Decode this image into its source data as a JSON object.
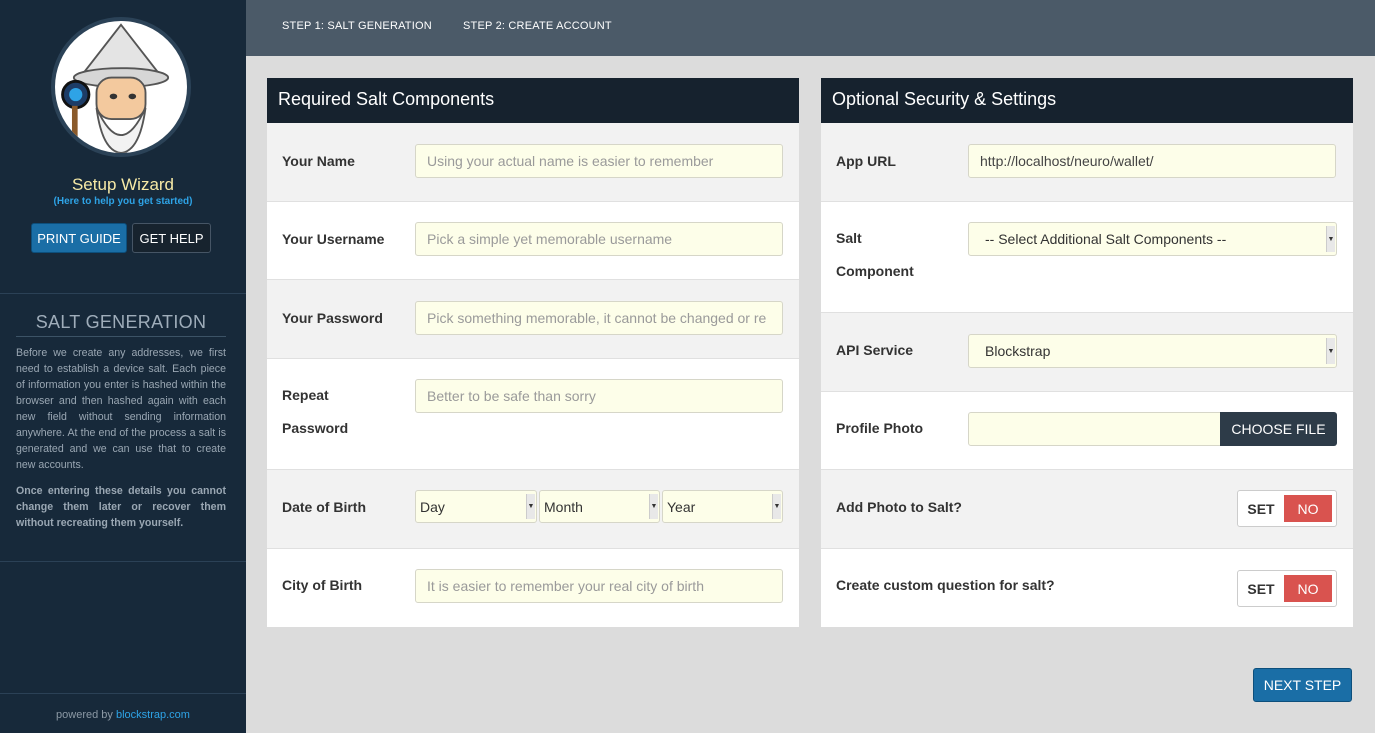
{
  "sidebar": {
    "title": "Setup Wizard",
    "subtitle": "(Here to help you get started)",
    "print_guide": "PRINT GUIDE",
    "get_help": "GET HELP",
    "section_title": "SALT GENERATION",
    "description": "Before we create any addresses, we first need to establish a device salt. Each piece of information you enter is hashed within the browser and then hashed again with each new field without sending information anywhere. At the end of the process a salt is generated and we can use that to create new accounts.",
    "warning": "Once entering these details you cannot change them later or recover them without recreating them yourself.",
    "powered_prefix": "powered by",
    "powered_link": "blockstrap.com"
  },
  "nav": {
    "step1": "STEP 1: SALT GENERATION",
    "step2": "STEP 2: CREATE ACCOUNT"
  },
  "required": {
    "title": "Required Salt Components",
    "name_label": "Your Name",
    "name_placeholder": "Using your actual name is easier to remember",
    "username_label": "Your Username",
    "username_placeholder": "Pick a simple yet memorable username",
    "password_label": "Your Password",
    "password_placeholder": "Pick something memorable, it cannot be changed or re",
    "repeat_label_1": "Repeat",
    "repeat_label_2": "Password",
    "repeat_placeholder": "Better to be safe than sorry",
    "dob_label": "Date of Birth",
    "dob_day": "Day",
    "dob_month": "Month",
    "dob_year": "Year",
    "city_label": "City of Birth",
    "city_placeholder": "It is easier to remember your real city of birth"
  },
  "optional": {
    "title": "Optional Security & Settings",
    "app_url_label": "App URL",
    "app_url_value": "http://localhost/neuro/wallet/",
    "salt_label_1": "Salt",
    "salt_label_2": "Component",
    "salt_select": "-- Select Additional Salt Components --",
    "api_label": "API Service",
    "api_value": "Blockstrap",
    "photo_label": "Profile Photo",
    "choose_file": "CHOOSE FILE",
    "add_photo_label": "Add Photo to Salt?",
    "custom_question_label": "Create custom question for salt?",
    "toggle_set": "SET",
    "toggle_no": "NO"
  },
  "next_step": "NEXT STEP",
  "colors": {
    "sidebar_bg": "#17293a",
    "panel_head": "#16222e",
    "accent_blue": "#1a6ea6",
    "toggle_red": "#d9534f",
    "input_bg": "#fdfee9"
  }
}
